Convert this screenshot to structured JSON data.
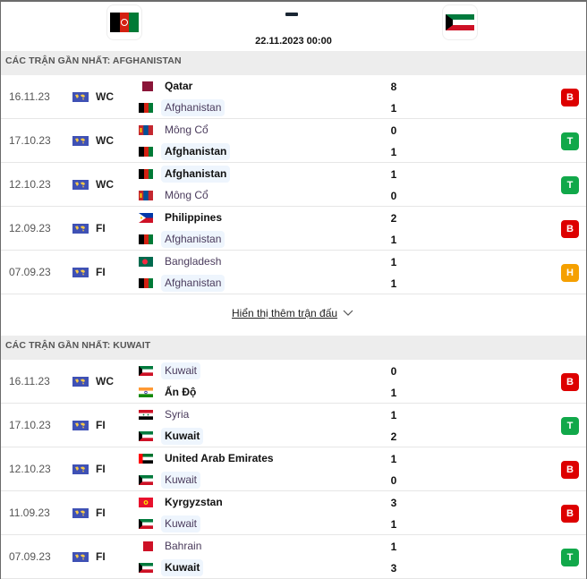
{
  "header": {
    "home_team": "Afghanistan",
    "away_team": "Kuwait",
    "score_separator": "–",
    "datetime": "22.11.2023 00:00"
  },
  "colors": {
    "win": "#11a84a",
    "loss": "#dd0000",
    "draw": "#f5a000",
    "section_bg": "#ededed",
    "highlight_bg": "#eef5fd"
  },
  "sections": [
    {
      "title": "CÁC TRẬN GẦN NHẤT: AFGHANISTAN",
      "matches": [
        {
          "date": "16.11.23",
          "comp": "WC",
          "home": "Qatar",
          "home_flag": "qatar",
          "away": "Afghanistan",
          "away_flag": "afghanistan",
          "home_score": "8",
          "away_score": "1",
          "winner": "home",
          "focus": "away",
          "result": "B",
          "result_type": "loss"
        },
        {
          "date": "17.10.23",
          "comp": "WC",
          "home": "Mông Cổ",
          "home_flag": "mongolia",
          "away": "Afghanistan",
          "away_flag": "afghanistan",
          "home_score": "0",
          "away_score": "1",
          "winner": "away",
          "focus": "away",
          "result": "T",
          "result_type": "win"
        },
        {
          "date": "12.10.23",
          "comp": "WC",
          "home": "Afghanistan",
          "home_flag": "afghanistan",
          "away": "Mông Cổ",
          "away_flag": "mongolia",
          "home_score": "1",
          "away_score": "0",
          "winner": "home",
          "focus": "home",
          "result": "T",
          "result_type": "win"
        },
        {
          "date": "12.09.23",
          "comp": "FI",
          "home": "Philippines",
          "home_flag": "philippines",
          "away": "Afghanistan",
          "away_flag": "afghanistan",
          "home_score": "2",
          "away_score": "1",
          "winner": "home",
          "focus": "away",
          "result": "B",
          "result_type": "loss"
        },
        {
          "date": "07.09.23",
          "comp": "FI",
          "home": "Bangladesh",
          "home_flag": "bangladesh",
          "away": "Afghanistan",
          "away_flag": "afghanistan",
          "home_score": "1",
          "away_score": "1",
          "winner": "none",
          "focus": "away",
          "result": "H",
          "result_type": "draw"
        }
      ],
      "show_more": "Hiển thị thêm trận đấu"
    },
    {
      "title": "CÁC TRẬN GẦN NHẤT: KUWAIT",
      "matches": [
        {
          "date": "16.11.23",
          "comp": "WC",
          "home": "Kuwait",
          "home_flag": "kuwait",
          "away": "Ấn Độ",
          "away_flag": "india",
          "home_score": "0",
          "away_score": "1",
          "winner": "away",
          "focus": "home",
          "result": "B",
          "result_type": "loss"
        },
        {
          "date": "17.10.23",
          "comp": "FI",
          "home": "Syria",
          "home_flag": "syria",
          "away": "Kuwait",
          "away_flag": "kuwait",
          "home_score": "1",
          "away_score": "2",
          "winner": "away",
          "focus": "away",
          "result": "T",
          "result_type": "win"
        },
        {
          "date": "12.10.23",
          "comp": "FI",
          "home": "United Arab Emirates",
          "home_flag": "uae",
          "away": "Kuwait",
          "away_flag": "kuwait",
          "home_score": "1",
          "away_score": "0",
          "winner": "home",
          "focus": "away",
          "result": "B",
          "result_type": "loss"
        },
        {
          "date": "11.09.23",
          "comp": "FI",
          "home": "Kyrgyzstan",
          "home_flag": "kyrgyzstan",
          "away": "Kuwait",
          "away_flag": "kuwait",
          "home_score": "3",
          "away_score": "1",
          "winner": "home",
          "focus": "away",
          "result": "B",
          "result_type": "loss"
        },
        {
          "date": "07.09.23",
          "comp": "FI",
          "home": "Bahrain",
          "home_flag": "bahrain",
          "away": "Kuwait",
          "away_flag": "kuwait",
          "home_score": "1",
          "away_score": "3",
          "winner": "away",
          "focus": "away",
          "result": "T",
          "result_type": "win"
        }
      ]
    }
  ]
}
